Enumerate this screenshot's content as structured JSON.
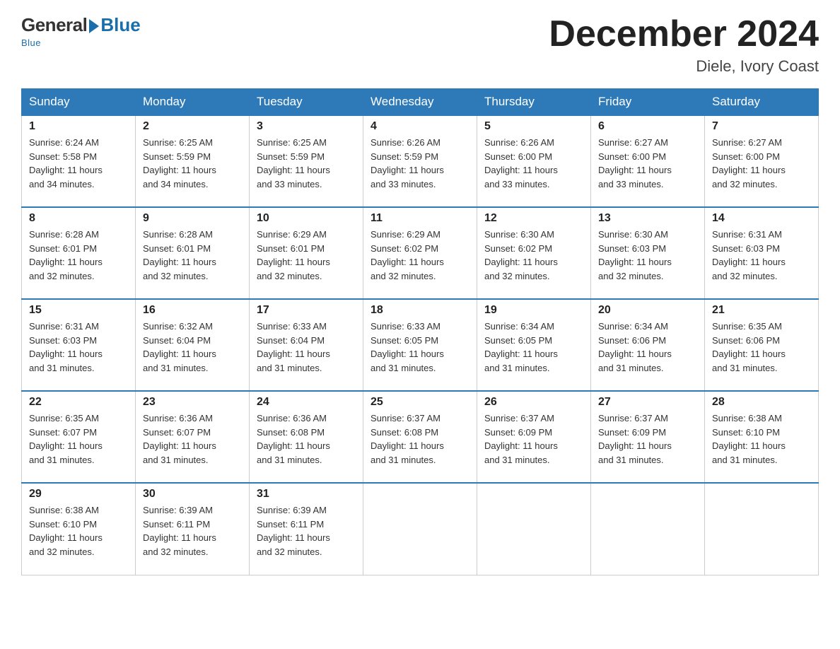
{
  "logo": {
    "general": "General",
    "blue": "Blue",
    "subtitle": "Blue"
  },
  "title": "December 2024",
  "subtitle": "Diele, Ivory Coast",
  "days_of_week": [
    "Sunday",
    "Monday",
    "Tuesday",
    "Wednesday",
    "Thursday",
    "Friday",
    "Saturday"
  ],
  "weeks": [
    [
      {
        "day": "1",
        "sunrise": "6:24 AM",
        "sunset": "5:58 PM",
        "daylight": "11 hours and 34 minutes."
      },
      {
        "day": "2",
        "sunrise": "6:25 AM",
        "sunset": "5:59 PM",
        "daylight": "11 hours and 34 minutes."
      },
      {
        "day": "3",
        "sunrise": "6:25 AM",
        "sunset": "5:59 PM",
        "daylight": "11 hours and 33 minutes."
      },
      {
        "day": "4",
        "sunrise": "6:26 AM",
        "sunset": "5:59 PM",
        "daylight": "11 hours and 33 minutes."
      },
      {
        "day": "5",
        "sunrise": "6:26 AM",
        "sunset": "6:00 PM",
        "daylight": "11 hours and 33 minutes."
      },
      {
        "day": "6",
        "sunrise": "6:27 AM",
        "sunset": "6:00 PM",
        "daylight": "11 hours and 33 minutes."
      },
      {
        "day": "7",
        "sunrise": "6:27 AM",
        "sunset": "6:00 PM",
        "daylight": "11 hours and 32 minutes."
      }
    ],
    [
      {
        "day": "8",
        "sunrise": "6:28 AM",
        "sunset": "6:01 PM",
        "daylight": "11 hours and 32 minutes."
      },
      {
        "day": "9",
        "sunrise": "6:28 AM",
        "sunset": "6:01 PM",
        "daylight": "11 hours and 32 minutes."
      },
      {
        "day": "10",
        "sunrise": "6:29 AM",
        "sunset": "6:01 PM",
        "daylight": "11 hours and 32 minutes."
      },
      {
        "day": "11",
        "sunrise": "6:29 AM",
        "sunset": "6:02 PM",
        "daylight": "11 hours and 32 minutes."
      },
      {
        "day": "12",
        "sunrise": "6:30 AM",
        "sunset": "6:02 PM",
        "daylight": "11 hours and 32 minutes."
      },
      {
        "day": "13",
        "sunrise": "6:30 AM",
        "sunset": "6:03 PM",
        "daylight": "11 hours and 32 minutes."
      },
      {
        "day": "14",
        "sunrise": "6:31 AM",
        "sunset": "6:03 PM",
        "daylight": "11 hours and 32 minutes."
      }
    ],
    [
      {
        "day": "15",
        "sunrise": "6:31 AM",
        "sunset": "6:03 PM",
        "daylight": "11 hours and 31 minutes."
      },
      {
        "day": "16",
        "sunrise": "6:32 AM",
        "sunset": "6:04 PM",
        "daylight": "11 hours and 31 minutes."
      },
      {
        "day": "17",
        "sunrise": "6:33 AM",
        "sunset": "6:04 PM",
        "daylight": "11 hours and 31 minutes."
      },
      {
        "day": "18",
        "sunrise": "6:33 AM",
        "sunset": "6:05 PM",
        "daylight": "11 hours and 31 minutes."
      },
      {
        "day": "19",
        "sunrise": "6:34 AM",
        "sunset": "6:05 PM",
        "daylight": "11 hours and 31 minutes."
      },
      {
        "day": "20",
        "sunrise": "6:34 AM",
        "sunset": "6:06 PM",
        "daylight": "11 hours and 31 minutes."
      },
      {
        "day": "21",
        "sunrise": "6:35 AM",
        "sunset": "6:06 PM",
        "daylight": "11 hours and 31 minutes."
      }
    ],
    [
      {
        "day": "22",
        "sunrise": "6:35 AM",
        "sunset": "6:07 PM",
        "daylight": "11 hours and 31 minutes."
      },
      {
        "day": "23",
        "sunrise": "6:36 AM",
        "sunset": "6:07 PM",
        "daylight": "11 hours and 31 minutes."
      },
      {
        "day": "24",
        "sunrise": "6:36 AM",
        "sunset": "6:08 PM",
        "daylight": "11 hours and 31 minutes."
      },
      {
        "day": "25",
        "sunrise": "6:37 AM",
        "sunset": "6:08 PM",
        "daylight": "11 hours and 31 minutes."
      },
      {
        "day": "26",
        "sunrise": "6:37 AM",
        "sunset": "6:09 PM",
        "daylight": "11 hours and 31 minutes."
      },
      {
        "day": "27",
        "sunrise": "6:37 AM",
        "sunset": "6:09 PM",
        "daylight": "11 hours and 31 minutes."
      },
      {
        "day": "28",
        "sunrise": "6:38 AM",
        "sunset": "6:10 PM",
        "daylight": "11 hours and 31 minutes."
      }
    ],
    [
      {
        "day": "29",
        "sunrise": "6:38 AM",
        "sunset": "6:10 PM",
        "daylight": "11 hours and 32 minutes."
      },
      {
        "day": "30",
        "sunrise": "6:39 AM",
        "sunset": "6:11 PM",
        "daylight": "11 hours and 32 minutes."
      },
      {
        "day": "31",
        "sunrise": "6:39 AM",
        "sunset": "6:11 PM",
        "daylight": "11 hours and 32 minutes."
      },
      null,
      null,
      null,
      null
    ]
  ],
  "labels": {
    "sunrise": "Sunrise:",
    "sunset": "Sunset:",
    "daylight": "Daylight:"
  }
}
